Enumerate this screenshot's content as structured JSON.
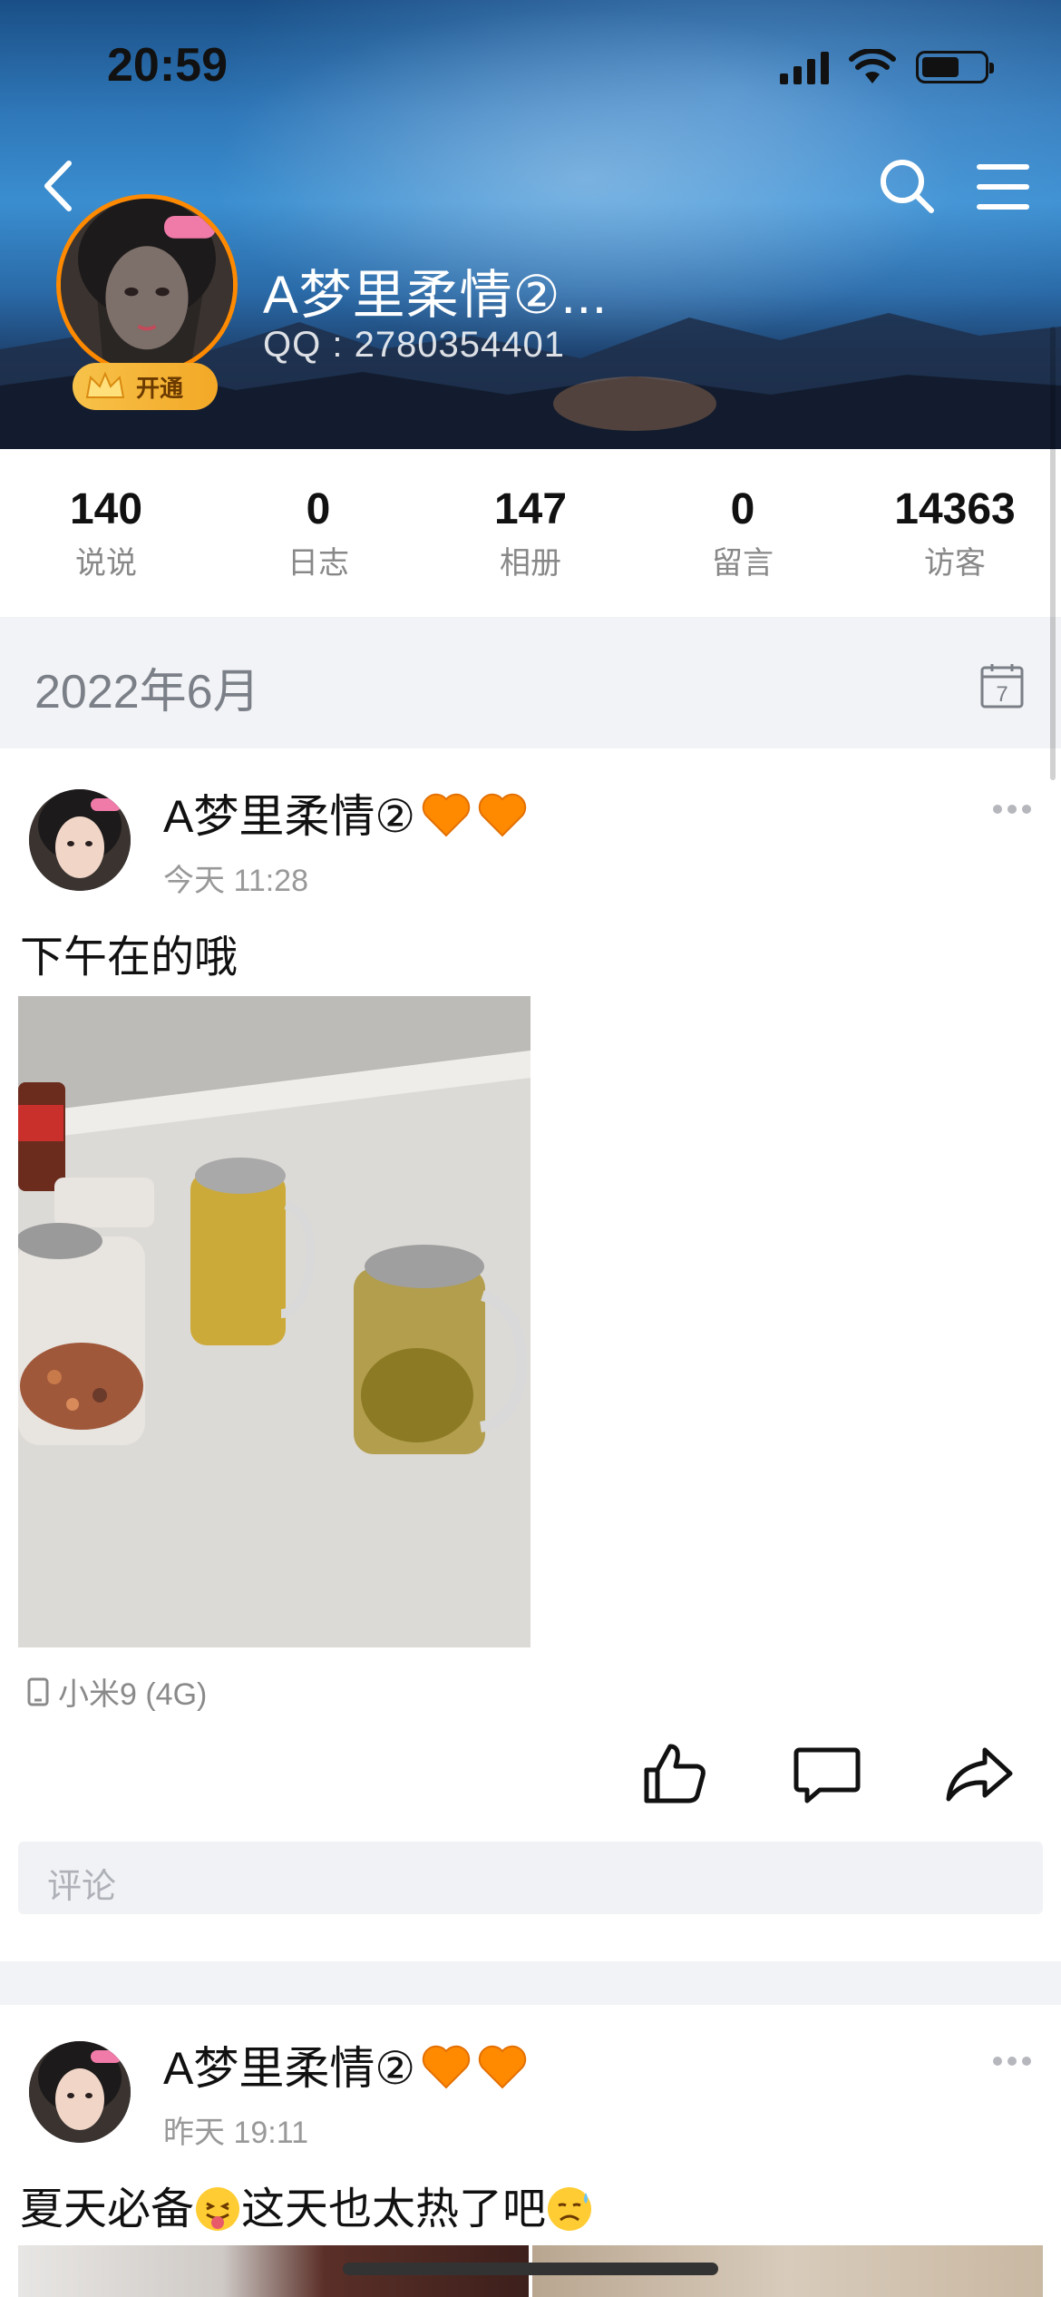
{
  "status_bar": {
    "time": "20:59"
  },
  "profile": {
    "name": "A梦里柔情②...",
    "qq": "QQ : 2780354401",
    "vip_label": "开通"
  },
  "stats": [
    {
      "value": "140",
      "label": "说说"
    },
    {
      "value": "0",
      "label": "日志"
    },
    {
      "value": "147",
      "label": "相册"
    },
    {
      "value": "0",
      "label": "留言"
    },
    {
      "value": "14363",
      "label": "访客"
    }
  ],
  "month_header": {
    "label": "2022年6月",
    "calendar_day": "7"
  },
  "posts": [
    {
      "author": "A梦里柔情②",
      "time": "今天 11:28",
      "text": "下午在的哦",
      "device": "小米9 (4G)",
      "comment_placeholder": "评论"
    },
    {
      "author": "A梦里柔情②",
      "time": "昨天 19:11",
      "text_before": "夏天必备",
      "text_middle": "这天也太热了吧"
    }
  ],
  "colors": {
    "vip_orange": "#ff8a00",
    "stat_label": "#888888",
    "section_bg": "#f2f3f6"
  }
}
